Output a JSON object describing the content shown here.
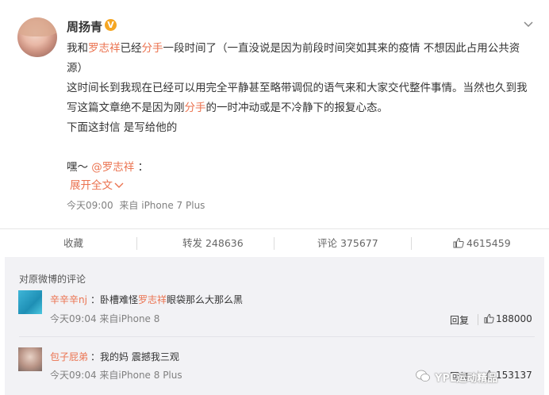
{
  "post": {
    "username": "周扬青",
    "verified_badge": "V",
    "more_icon": "chevron-down-icon",
    "content": {
      "line1_pre": "我和",
      "line1_name": "罗志祥",
      "line1_mid": "已经",
      "line1_hl": "分手",
      "line1_post": "一段时间了（一直没说是因为前段时间突如其来的疫情 不想因此占用公共资源）",
      "line2_pre": "这时间长到我现在已经可以用完全平静甚至略带调侃的语气来和大家交代整件事情。当然也久到我写这篇文章绝不是因为刚",
      "line2_hl": "分手",
      "line2_post": "的一时冲动或是不冷静下的报复心态。",
      "line3": "下面这封信 是写给他的",
      "line4_pre": "嘿～",
      "line4_mention": "@罗志祥",
      "line4_post": "："
    },
    "expand_label": "展开全文",
    "time": "今天09:00",
    "source": "来自 iPhone 7 Plus"
  },
  "actions": {
    "favorite": "收藏",
    "repost": "转发 248636",
    "comment": "评论 375677",
    "like_count": "4615459"
  },
  "comments": {
    "title": "对原微博的评论",
    "items": [
      {
        "name": "辛辛辛nj",
        "separator": "：",
        "text_pre": "卧槽难怪",
        "text_hl": "罗志祥",
        "text_post": "眼袋那么大那么黑",
        "time": "今天09:04",
        "source": "来自iPhone 8",
        "reply": "回复",
        "likes": "188000"
      },
      {
        "name": "包子屁弟",
        "separator": "：",
        "text": "我的妈 震撼我三观",
        "time": "今天09:04",
        "source": "来自iPhone 8 Plus",
        "reply": "回复",
        "likes": "153137"
      }
    ]
  },
  "watermark": "YPL运动精品"
}
